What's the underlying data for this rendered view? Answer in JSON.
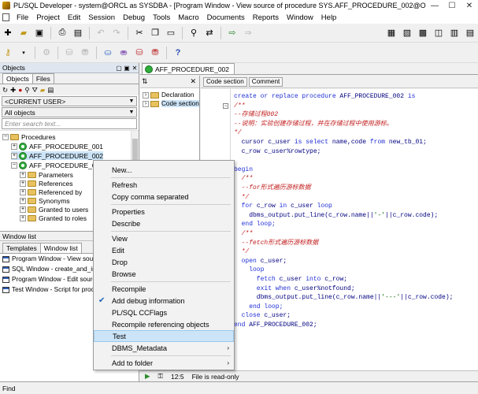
{
  "window": {
    "title": "PL/SQL Developer - system@ORCL as SYSDBA - [Program Window - View source of procedure SYS.AFF_PROCEDURE_002@O...",
    "minimize": "—",
    "maximize": "☐",
    "close": "✕"
  },
  "menubar": {
    "items": [
      {
        "label": "File"
      },
      {
        "label": "Project"
      },
      {
        "label": "Edit"
      },
      {
        "label": "Session"
      },
      {
        "label": "Debug"
      },
      {
        "label": "Tools"
      },
      {
        "label": "Macro"
      },
      {
        "label": "Documents"
      },
      {
        "label": "Reports"
      },
      {
        "label": "Window"
      },
      {
        "label": "Help"
      }
    ]
  },
  "objects_panel": {
    "title": "Objects",
    "tabs": [
      "Objects",
      "Files"
    ],
    "user_combo": "<CURRENT USER>",
    "objects_combo": "All objects",
    "search_placeholder": "Enter search text...",
    "tree": {
      "root": "Procedures",
      "items": [
        "AFF_PROCEDURE_001",
        "AFF_PROCEDURE_002",
        "AFF_PROCEDURE_00"
      ],
      "children": [
        "Parameters",
        "References",
        "Referenced by",
        "Synonyms",
        "Granted to users",
        "Granted to roles"
      ]
    }
  },
  "window_list": {
    "title": "Window list",
    "tabs": [
      "Templates",
      "Window list"
    ],
    "items": [
      "Program Window - View source of",
      "SQL Window - create_and_inser",
      "Program Window - Edit source of",
      "Test Window - Script for procedu"
    ]
  },
  "editor": {
    "tab_label": "AFF_PROCEDURE_002",
    "structure": {
      "items": [
        "Declaration",
        "Code section"
      ]
    },
    "buttons": [
      "Code section",
      "Comment"
    ],
    "lines": [
      [
        {
          "c": "kw",
          "t": "create or replace procedure "
        },
        {
          "c": "id",
          "t": "AFF_PROCEDURE_002"
        },
        {
          "c": "kw",
          "t": " is"
        }
      ],
      [
        {
          "c": "cm",
          "t": "/**"
        }
      ],
      [
        {
          "c": "cm",
          "t": "--存储过程002"
        }
      ],
      [
        {
          "c": "cm",
          "t": "--说明：实验创建存储过程，并在存储过程中使用游标。"
        }
      ],
      [
        {
          "c": "cm",
          "t": "*/"
        }
      ],
      [
        {
          "c": "id",
          "t": "  cursor c_user "
        },
        {
          "c": "kw",
          "t": "is select "
        },
        {
          "c": "id",
          "t": "name,code "
        },
        {
          "c": "kw",
          "t": "from "
        },
        {
          "c": "id",
          "t": "new_tb_01;"
        }
      ],
      [
        {
          "c": "id",
          "t": "  c_row c_user%rowtype;"
        }
      ],
      [
        {
          "c": "id",
          "t": ""
        }
      ],
      [
        {
          "c": "kw",
          "t": "begin"
        }
      ],
      [
        {
          "c": "cm",
          "t": "  /**"
        }
      ],
      [
        {
          "c": "cm",
          "t": "  --for形式遍历游标数据"
        }
      ],
      [
        {
          "c": "cm",
          "t": "  */"
        }
      ],
      [
        {
          "c": "kw",
          "t": "  for "
        },
        {
          "c": "id",
          "t": "c_row "
        },
        {
          "c": "kw",
          "t": "in "
        },
        {
          "c": "id",
          "t": "c_user "
        },
        {
          "c": "kw",
          "t": "loop"
        }
      ],
      [
        {
          "c": "id",
          "t": "    dbms_output.put_line(c_row.name||"
        },
        {
          "c": "st",
          "t": "'-'"
        },
        {
          "c": "id",
          "t": "||c_row.code);"
        }
      ],
      [
        {
          "c": "kw",
          "t": "  end loop;"
        }
      ],
      [
        {
          "c": "cm",
          "t": "  /**"
        }
      ],
      [
        {
          "c": "cm",
          "t": "  --fetch形式遍历游标数据"
        }
      ],
      [
        {
          "c": "cm",
          "t": "  */"
        }
      ],
      [
        {
          "c": "kw",
          "t": "  open "
        },
        {
          "c": "id",
          "t": "c_user;"
        }
      ],
      [
        {
          "c": "kw",
          "t": "    loop"
        }
      ],
      [
        {
          "c": "kw",
          "t": "      fetch "
        },
        {
          "c": "id",
          "t": "c_user "
        },
        {
          "c": "kw",
          "t": "into "
        },
        {
          "c": "id",
          "t": "c_row;"
        }
      ],
      [
        {
          "c": "kw",
          "t": "      exit when "
        },
        {
          "c": "id",
          "t": "c_user%notfound;"
        }
      ],
      [
        {
          "c": "id",
          "t": "      dbms_output.put_line(c_row.name||"
        },
        {
          "c": "st",
          "t": "'---'"
        },
        {
          "c": "id",
          "t": "||c_row.code);"
        }
      ],
      [
        {
          "c": "kw",
          "t": "    end loop;"
        }
      ],
      [
        {
          "c": "kw",
          "t": "  close "
        },
        {
          "c": "id",
          "t": "c_user;"
        }
      ],
      [
        {
          "c": "kw",
          "t": "end "
        },
        {
          "c": "id",
          "t": "AFF_PROCEDURE_002;"
        }
      ]
    ]
  },
  "statusbar": {
    "position": "12:5",
    "readonly": "File is read-only"
  },
  "findbar": {
    "label": "Find"
  },
  "context_menu": {
    "items": [
      {
        "label": "New..."
      },
      {
        "label": "Refresh"
      },
      {
        "label": "Copy comma separated"
      },
      {
        "label": "Properties"
      },
      {
        "label": "Describe"
      },
      {
        "label": "View"
      },
      {
        "label": "Edit"
      },
      {
        "label": "Drop"
      },
      {
        "label": "Browse"
      },
      {
        "label": "Recompile"
      },
      {
        "label": "Add debug information",
        "checked": true
      },
      {
        "label": "PL/SQL CCFlags"
      },
      {
        "label": "Recompile referencing objects"
      },
      {
        "label": "Test",
        "highlighted": true
      },
      {
        "label": "DBMS_Metadata",
        "submenu": true
      },
      {
        "label": "Add to folder",
        "submenu": true
      }
    ]
  },
  "colors": {
    "keyword": "#1f2fd6",
    "comment": "#c32020",
    "identifier": "#000080",
    "selection": "#cce4f7",
    "procedure_icon": "#2fae3a"
  }
}
